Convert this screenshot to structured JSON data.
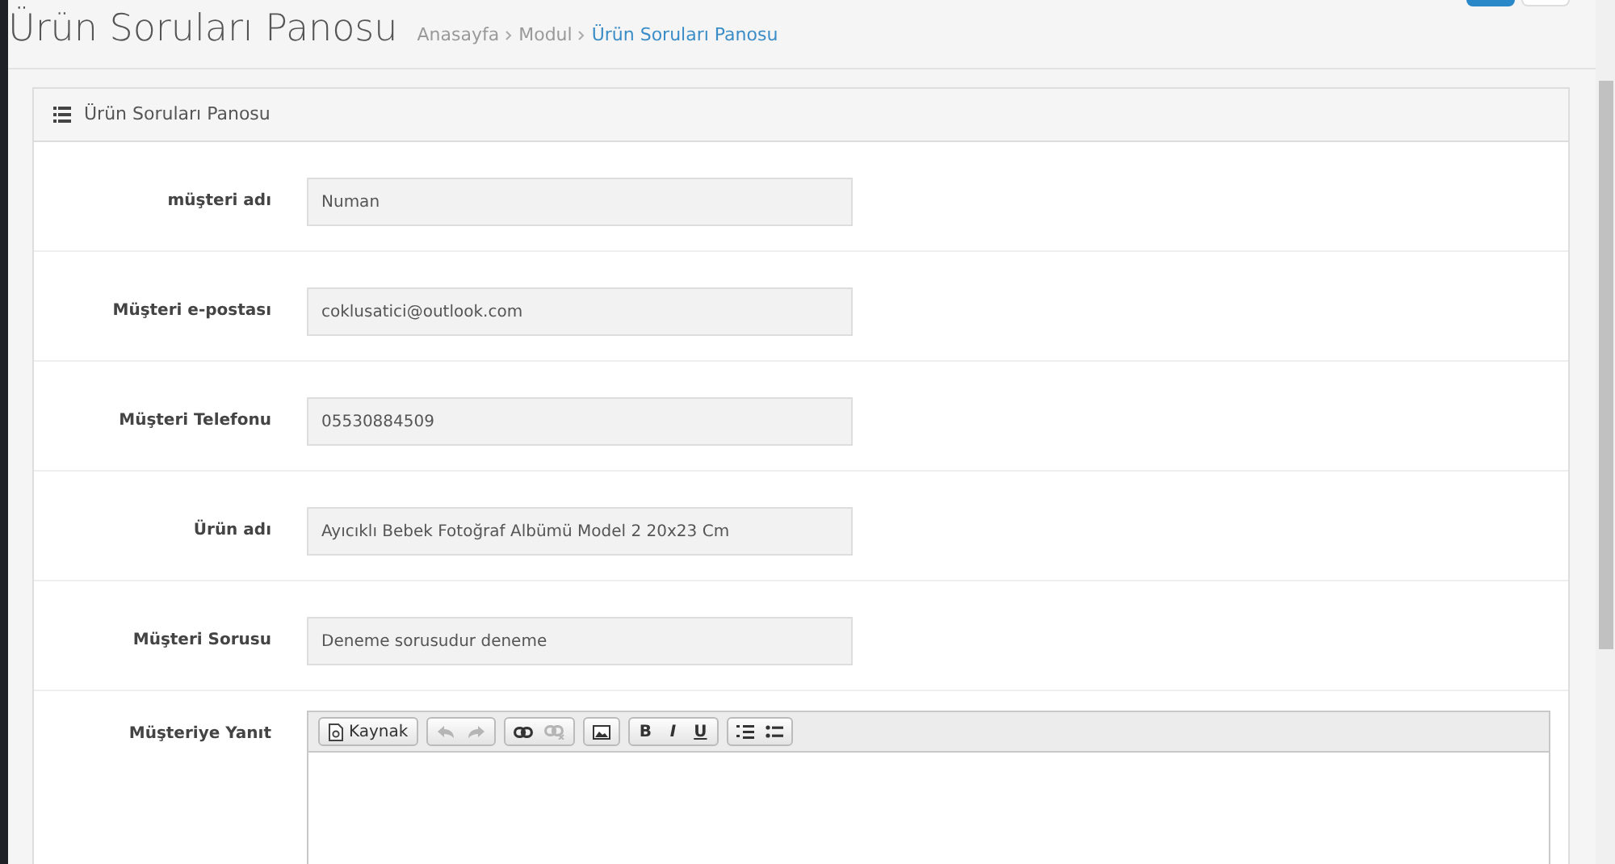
{
  "page": {
    "title": "Ürün Soruları Panosu",
    "breadcrumb": [
      {
        "label": "Anasayfa",
        "selected": false
      },
      {
        "label": "Modul",
        "selected": false
      },
      {
        "label": "Ürün Soruları Panosu",
        "selected": true
      }
    ]
  },
  "panel": {
    "title": "Ürün Soruları Panosu",
    "fields": [
      {
        "label": "müşteri adı",
        "value": "Numan"
      },
      {
        "label": "Müşteri e-postası",
        "value": "coklusatici@outlook.com"
      },
      {
        "label": "Müşteri Telefonu",
        "value": "05530884509"
      },
      {
        "label": "Ürün adı",
        "value": "Ayıcıklı Bebek Fotoğraf Albümü Model 2 20x23 Cm"
      },
      {
        "label": "Müşteri Sorusu",
        "value": "Deneme sorusudur deneme"
      }
    ],
    "editor": {
      "label": "Müşteriye Yanıt",
      "toolbar": [
        [
          {
            "kind": "source",
            "label": "Kaynak",
            "disabled": false
          }
        ],
        [
          {
            "kind": "undo",
            "disabled": true
          },
          {
            "kind": "redo",
            "disabled": true
          }
        ],
        [
          {
            "kind": "link",
            "disabled": false
          },
          {
            "kind": "unlink",
            "disabled": true
          }
        ],
        [
          {
            "kind": "image",
            "disabled": false
          }
        ],
        [
          {
            "kind": "bold",
            "label": "B",
            "disabled": false
          },
          {
            "kind": "italic",
            "label": "I",
            "disabled": false
          },
          {
            "kind": "underline",
            "label": "U",
            "disabled": false
          }
        ],
        [
          {
            "kind": "ordered-list",
            "disabled": false
          },
          {
            "kind": "bullet-list",
            "disabled": false
          }
        ]
      ]
    }
  }
}
